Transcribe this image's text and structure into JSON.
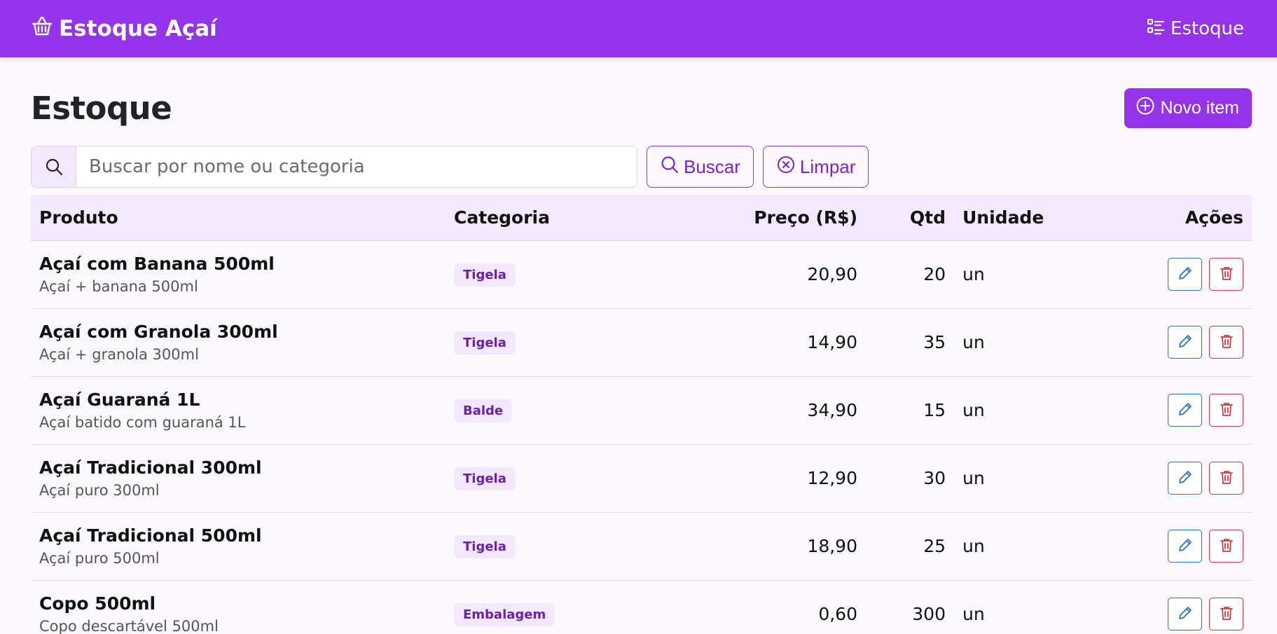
{
  "navbar": {
    "brand": "Estoque Açaí",
    "brand_icon": "basket-icon",
    "link": "Estoque",
    "link_icon": "list-check-icon",
    "color": "#9333ea"
  },
  "page": {
    "title": "Estoque",
    "new_button": "Novo item"
  },
  "search": {
    "placeholder": "Buscar por nome ou categoria",
    "value": "",
    "search_button": "Buscar",
    "clear_button": "Limpar"
  },
  "table": {
    "headers": {
      "product": "Produto",
      "category": "Categoria",
      "price": "Preço (R$)",
      "qty": "Qtd",
      "unit": "Unidade",
      "actions": "Ações"
    },
    "rows": [
      {
        "name": "Açaí com Banana 500ml",
        "desc": "Açaí + banana 500ml",
        "category": "Tigela",
        "price": "20,90",
        "qty": "20",
        "unit": "un"
      },
      {
        "name": "Açaí com Granola 300ml",
        "desc": "Açaí + granola 300ml",
        "category": "Tigela",
        "price": "14,90",
        "qty": "35",
        "unit": "un"
      },
      {
        "name": "Açaí Guaraná 1L",
        "desc": "Açaí batido com guaraná 1L",
        "category": "Balde",
        "price": "34,90",
        "qty": "15",
        "unit": "un"
      },
      {
        "name": "Açaí Tradicional 300ml",
        "desc": "Açaí puro 300ml",
        "category": "Tigela",
        "price": "12,90",
        "qty": "30",
        "unit": "un"
      },
      {
        "name": "Açaí Tradicional 500ml",
        "desc": "Açaí puro 500ml",
        "category": "Tigela",
        "price": "18,90",
        "qty": "25",
        "unit": "un"
      },
      {
        "name": "Copo 500ml",
        "desc": "Copo descartável 500ml",
        "category": "Embalagem",
        "price": "0,60",
        "qty": "300",
        "unit": "un"
      }
    ]
  },
  "colors": {
    "accent": "#9333ea",
    "edit": "#2f72c4",
    "delete": "#c83c47",
    "badge_bg": "#f3e8ff"
  }
}
